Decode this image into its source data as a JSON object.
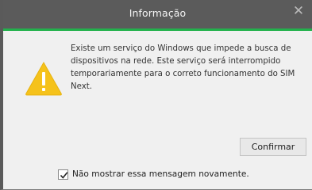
{
  "dialog": {
    "title": "Informação",
    "close_icon": "close-icon",
    "warning_icon": "warning-triangle-icon",
    "message": "Existe um serviço do Windows que impede a busca de dispositivos na rede. Este serviço será interrompido temporariamente para o correto funcionamento do SIM Next.",
    "confirm_label": "Confirmar",
    "checkbox_label": "Não mostrar essa mensagem novamente.",
    "checkbox_checked": true
  },
  "colors": {
    "titlebar": "#5b5b5b",
    "accent": "#22b14c",
    "warning": "#f5c21b"
  }
}
